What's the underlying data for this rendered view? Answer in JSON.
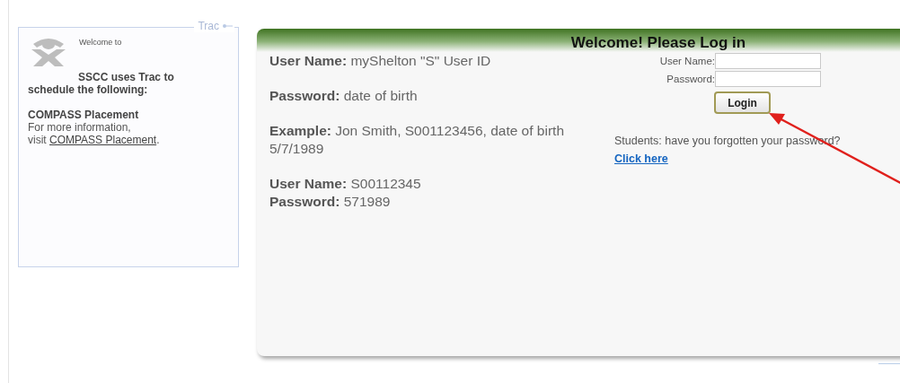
{
  "sidebar": {
    "legend": "Trac",
    "welcome": "Welcome to",
    "heading": "SSCC uses Trac to schedule the following:",
    "service": "COMPASS Placement",
    "info": "For more information,",
    "visit": "visit",
    "link": "COMPASS Placement",
    "after_link": "."
  },
  "login_panel": {
    "title": "Welcome! Please Log in",
    "instructions": [
      [
        {
          "label": "User Name:",
          "value": "myShelton \"S\" User ID"
        }
      ],
      [
        {
          "label": "Password:",
          "value": "date of birth"
        }
      ],
      [
        {
          "label": "Example:",
          "value": "Jon Smith, S001123456, date of birth 5/7/1989"
        }
      ],
      [
        {
          "label": "User Name:",
          "value": "S00112345"
        },
        {
          "label": "Password:",
          "value": "571989"
        }
      ]
    ],
    "fields": [
      {
        "label": "User Name:"
      },
      {
        "label": "Password:"
      }
    ],
    "button": "Login",
    "forgot": {
      "text": "Students: have you forgotten your password?",
      "link": "Click here"
    }
  }
}
